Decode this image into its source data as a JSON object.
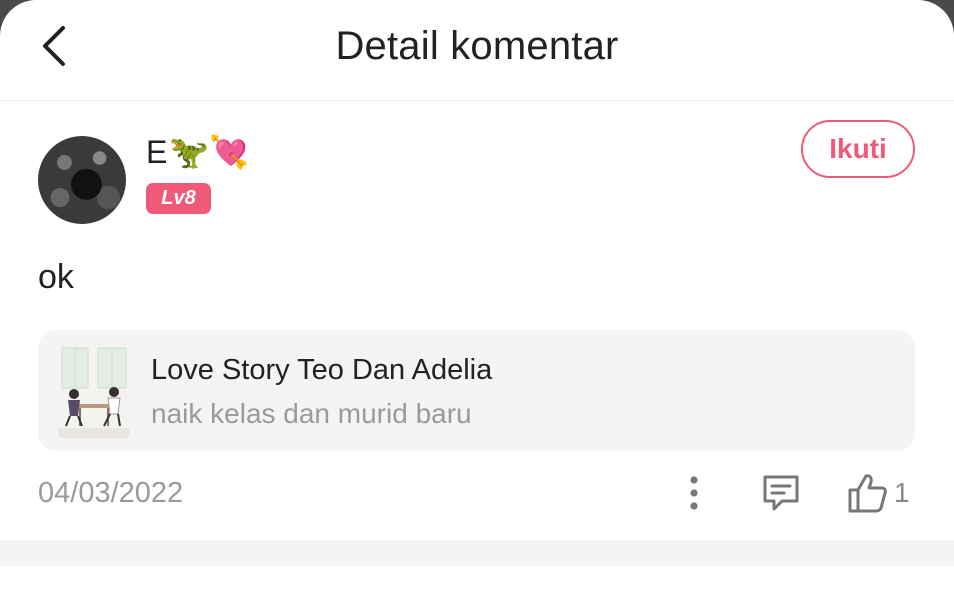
{
  "header": {
    "title": "Detail komentar"
  },
  "user": {
    "name": "E",
    "name_emojis": "🦖💘",
    "level": "Lv8"
  },
  "follow": {
    "label": "Ikuti"
  },
  "comment": {
    "text": "ok"
  },
  "story": {
    "title": "Love Story Teo Dan Adelia",
    "subtitle": "naik kelas dan murid baru"
  },
  "meta": {
    "date": "04/03/2022",
    "likes": "1"
  },
  "colors": {
    "accent": "#f05a78",
    "muted": "#9a9a9a",
    "card_bg": "#f4f4f4"
  },
  "icons": [
    "back-arrow-icon",
    "more-vertical-icon",
    "comment-icon",
    "thumbs-up-icon"
  ]
}
